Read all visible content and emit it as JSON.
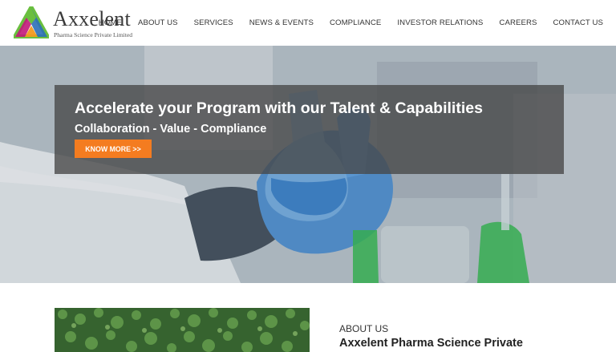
{
  "brand": {
    "name": "Axxelent",
    "tagline": "Pharma Science Private Limited",
    "colors": {
      "accent": "#f47c20",
      "logo_green": "#6abf3f",
      "logo_blue": "#2c6fb7",
      "logo_magenta": "#c2187a",
      "logo_orange": "#f39a1f"
    }
  },
  "nav": {
    "items": [
      {
        "label": "HOME"
      },
      {
        "label": "ABOUT US"
      },
      {
        "label": "SERVICES"
      },
      {
        "label": "NEWS & EVENTS"
      },
      {
        "label": "COMPLIANCE"
      },
      {
        "label": "INVESTOR RELATIONS"
      },
      {
        "label": "CAREERS"
      },
      {
        "label": "CONTACT US"
      }
    ]
  },
  "hero": {
    "title": "Accelerate your Program with our Talent & Capabilities",
    "subtitle": "Collaboration - Value - Compliance",
    "button_label": "KNOW MORE >>",
    "image_icon": "laboratory-scientist-flask-photo"
  },
  "about": {
    "label": "ABOUT US",
    "heading": "Axxelent Pharma Science Private",
    "image_icon": "green-foliage-photo"
  }
}
